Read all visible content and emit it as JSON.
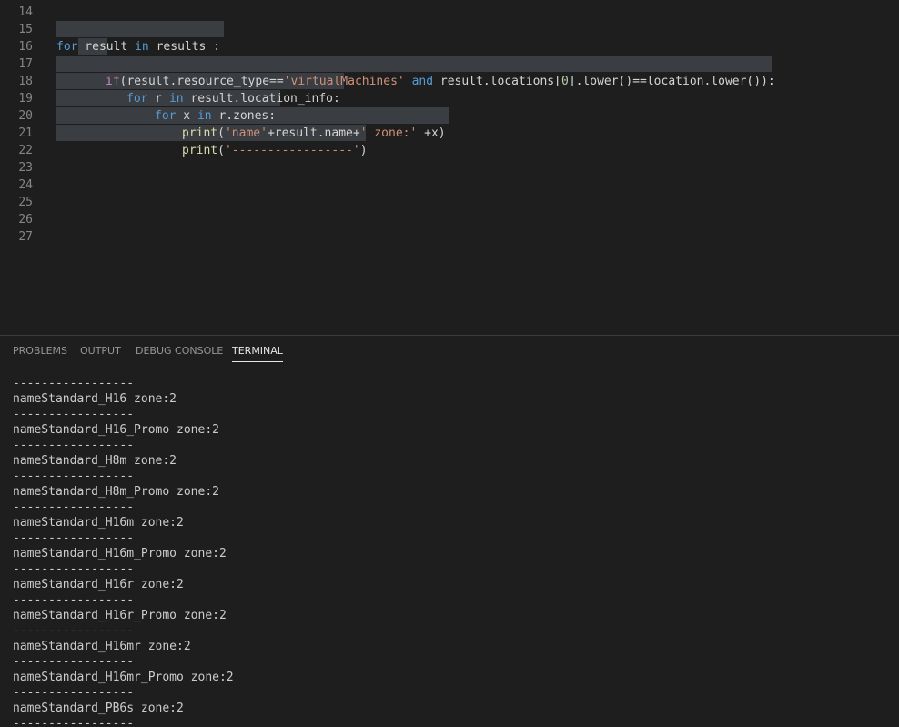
{
  "editor": {
    "line_numbers": [
      "14",
      "15",
      "16",
      "17",
      "18",
      "19",
      "20",
      "21",
      "22",
      "23",
      "24",
      "25",
      "26",
      "27"
    ],
    "code": {
      "l15": {
        "kw_for": "for",
        "t1": " result ",
        "kw_in": "in",
        "t2": " results :"
      },
      "l17": {
        "if": "if",
        "t1": "(result.resource_type==",
        "s1": "'virtualMachines'",
        "t2": " ",
        "and": "and",
        "t3": " result.locations[",
        "n0": "0",
        "t4": "].lower()==location.lower()):"
      },
      "l18": {
        "kw_for": "for",
        "t1": " r ",
        "kw_in": "in",
        "t2": " result.location_info:"
      },
      "l19": {
        "kw_for": "for",
        "t1": " x ",
        "kw_in": "in",
        "t2": " r.zones:"
      },
      "l20": {
        "fn": "print",
        "t1": "(",
        "s1": "'name'",
        "t2": "+result.name+",
        "s2": "' zone:'",
        "t3": " +x)"
      },
      "l21": {
        "fn": "print",
        "t1": "(",
        "s1": "'-----------------'",
        "t2": ")"
      }
    }
  },
  "panel": {
    "tabs": [
      "PROBLEMS",
      "OUTPUT",
      "DEBUG CONSOLE",
      "TERMINAL"
    ],
    "active_tab": "TERMINAL",
    "terminal_lines": [
      "-----------------",
      "nameStandard_H16 zone:2",
      "-----------------",
      "nameStandard_H16_Promo zone:2",
      "-----------------",
      "nameStandard_H8m zone:2",
      "-----------------",
      "nameStandard_H8m_Promo zone:2",
      "-----------------",
      "nameStandard_H16m zone:2",
      "-----------------",
      "nameStandard_H16m_Promo zone:2",
      "-----------------",
      "nameStandard_H16r zone:2",
      "-----------------",
      "nameStandard_H16r_Promo zone:2",
      "-----------------",
      "nameStandard_H16mr zone:2",
      "-----------------",
      "nameStandard_H16mr_Promo zone:2",
      "-----------------",
      "nameStandard_PB6s zone:2",
      "-----------------"
    ]
  },
  "colors": {
    "background": "#1e1e1e",
    "selection": "#3a3d41",
    "keyword": "#569cd6",
    "control": "#c586c0",
    "function": "#dcdcaa",
    "string": "#ce9178"
  }
}
